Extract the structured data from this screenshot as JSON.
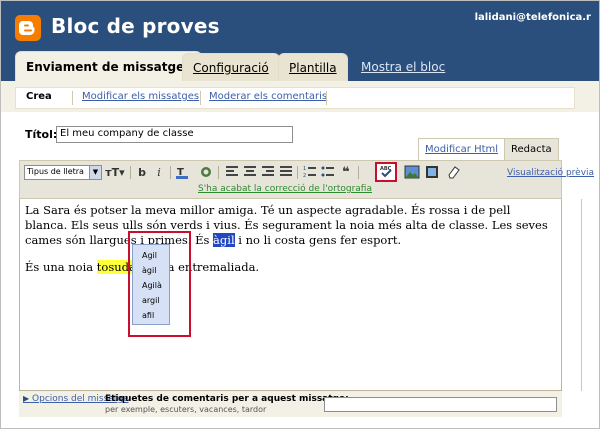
{
  "header": {
    "blog_title": "Bloc de proves",
    "user_email": "lalidani@telefonica.r",
    "brand_color": "#f57d00",
    "header_color": "#2b4f7c"
  },
  "tabs": [
    {
      "label": "Enviament de missatges",
      "active": true
    },
    {
      "label": "Configuració",
      "active": false
    },
    {
      "label": "Plantilla",
      "active": false
    }
  ],
  "view_blog_link": "Mostra el  bloc",
  "subtabs": [
    {
      "label": "Crea",
      "active": true
    },
    {
      "label": "Modificar els missatges",
      "active": false
    },
    {
      "label": "Moderar els comentaris",
      "active": false
    }
  ],
  "post": {
    "title_label": "Títol:",
    "title_value": "El meu company de classe"
  },
  "mode_tabs": {
    "html": "Modificar Html",
    "compose": "Redacta"
  },
  "toolbar": {
    "font_select": "Tipus de lletra",
    "icons": [
      "font-size-icon",
      "bold-icon",
      "italic-icon",
      "text-color-icon",
      "link-icon",
      "align-left-icon",
      "align-center-icon",
      "align-right-icon",
      "align-justify-icon",
      "numbered-list-icon",
      "bullet-list-icon",
      "blockquote-icon",
      "spellcheck-icon",
      "image-icon",
      "video-icon",
      "remove-format-icon"
    ],
    "spellcheck_message": "S'ha acabat la correcció de l'ortografia",
    "preview_link": "Visualització prèvia"
  },
  "editor": {
    "p1_before": "La Sara és potser la meva millor amiga. Té un aspecte agradable. És rossa i de pell blanca. Els seus ulls són verds i viu",
    "p1_hidden_a": "s",
    "p1_mid": ".  És segurament la noia més alta de classe. Les seves cames són llargues i primes. És ",
    "p1_selected": "àgil",
    "p1_after": " i no li costa gens fer esport.",
    "p2_before": "És una noia ",
    "p2_highlight": "tosuda",
    "p2_after": " i poca entremaliada.",
    "p2_hidden_b": " i poca"
  },
  "suggestions": [
    "Agil",
    "àgil",
    "Agilà",
    "argil",
    "afil"
  ],
  "bottom": {
    "options_link": "Opcions del missatge",
    "labels_title": "Etiquetes de comentaris per a aquest missatge:",
    "labels_hint": "per exemple, escuters, vacances, tardor",
    "labels_value": ""
  }
}
